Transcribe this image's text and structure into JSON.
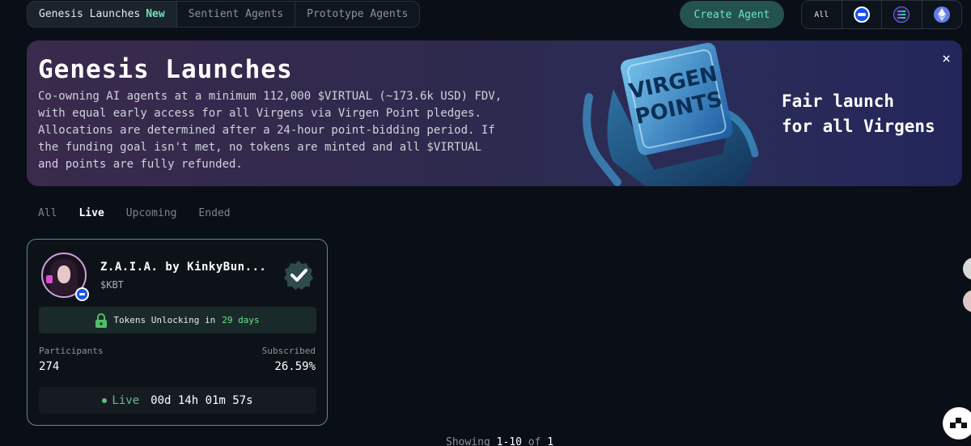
{
  "nav": {
    "tabs": [
      {
        "label": "Genesis Launches",
        "badge": "New"
      },
      {
        "label": "Sentient Agents"
      },
      {
        "label": "Prototype Agents"
      }
    ],
    "create_label": "Create Agent",
    "chains": [
      {
        "label": "All"
      },
      {
        "icon": "base-chain-icon"
      },
      {
        "icon": "solana-chain-icon"
      },
      {
        "icon": "ethereum-chain-icon"
      }
    ]
  },
  "banner": {
    "title": "Genesis Launches",
    "description": "Co-owning AI agents at a minimum 112,000 $VIRTUAL (~173.6k USD) FDV, with equal early access for all Virgens via Virgen Point pledges. Allocations are determined after a 24-hour point-bidding period. If the funding goal isn't met, no tokens are minted and all $VIRTUAL and points are fully refunded.",
    "art_text_line1": "VIRGEN",
    "art_text_line2": "POINTS",
    "tagline_line1": "Fair launch",
    "tagline_line2": "for all Virgens",
    "close_icon": "×"
  },
  "filters": [
    {
      "label": "All"
    },
    {
      "label": "Live",
      "active": true
    },
    {
      "label": "Upcoming"
    },
    {
      "label": "Ended"
    }
  ],
  "card": {
    "name": "Z.A.I.A. by KinkyBun...",
    "ticker": "$KBT",
    "unlock_prefix": "Tokens Unlocking in",
    "unlock_days": "29 days",
    "participants_label": "Participants",
    "participants_value": "274",
    "subscribed_label": "Subscribed",
    "subscribed_value": "26.59%",
    "status_label": "Live",
    "countdown": "00d 14h 01m 57s"
  },
  "pagination": {
    "prefix": "Showing",
    "range": "1-10",
    "of": "of",
    "total": "1"
  },
  "colors": {
    "accent": "#6fe3c8",
    "live_green": "#5fbf7c",
    "card_border": "#5a8e92"
  }
}
